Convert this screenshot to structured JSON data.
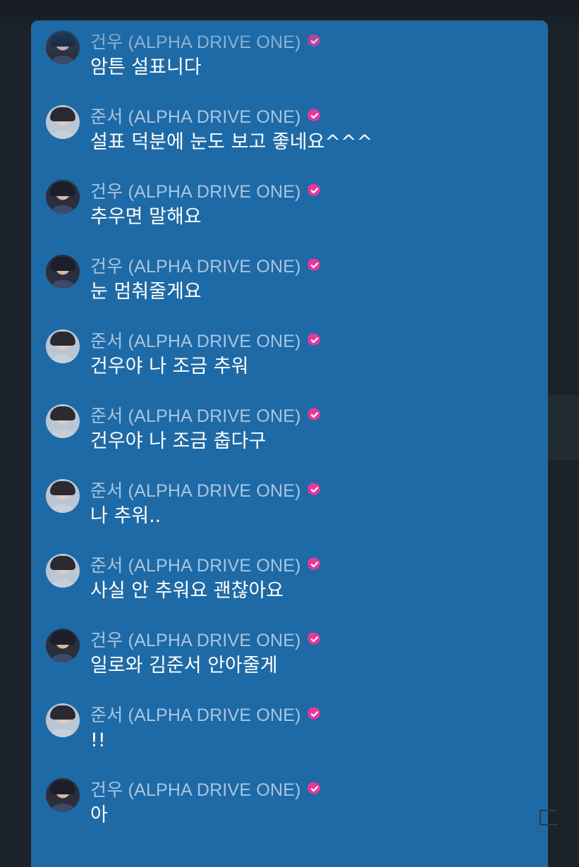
{
  "messages": [
    {
      "author": "건우 (ALPHA DRIVE ONE)",
      "text": "암튼 설표니다",
      "avatar": "gunwoo-avatar"
    },
    {
      "author": "준서 (ALPHA DRIVE ONE)",
      "text": "설표 덕분에 눈도 보고 좋네요^^^",
      "avatar": "junseo-avatar"
    },
    {
      "author": "건우 (ALPHA DRIVE ONE)",
      "text": "추우면 말해요",
      "avatar": "gunwoo-avatar"
    },
    {
      "author": "건우 (ALPHA DRIVE ONE)",
      "text": "눈 멈춰줄게요",
      "avatar": "gunwoo-avatar"
    },
    {
      "author": "준서 (ALPHA DRIVE ONE)",
      "text": "건우야 나 조금 추워",
      "avatar": "junseo-avatar"
    },
    {
      "author": "준서 (ALPHA DRIVE ONE)",
      "text": "건우야 나 조금 춥다구",
      "avatar": "junseo-avatar"
    },
    {
      "author": "준서 (ALPHA DRIVE ONE)",
      "text": "나 추워..",
      "avatar": "junseo-avatar"
    },
    {
      "author": "준서 (ALPHA DRIVE ONE)",
      "text": "사실 안 추워요 괜찮아요",
      "avatar": "junseo-avatar"
    },
    {
      "author": "건우 (ALPHA DRIVE ONE)",
      "text": "일로와 김준서 안아줄게",
      "avatar": "gunwoo-avatar"
    },
    {
      "author": "준서 (ALPHA DRIVE ONE)",
      "text": "!!",
      "avatar": "junseo-avatar"
    },
    {
      "author": "건우 (ALPHA DRIVE ONE)",
      "text": "아",
      "avatar": "gunwoo-avatar"
    }
  ],
  "colors": {
    "panel_bg": "#1e6aa6",
    "page_bg": "#1b2229",
    "name_text": "#a9c6e0",
    "message_text": "#ffffff",
    "verified_badge": "#e8379a"
  },
  "icons": {
    "verified": "verified-badge-icon"
  }
}
